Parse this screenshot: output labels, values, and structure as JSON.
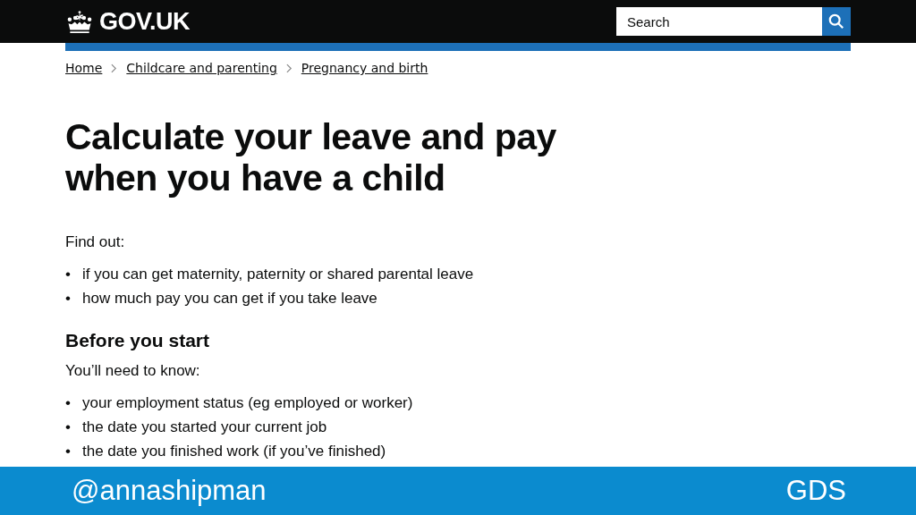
{
  "header": {
    "logo": "GOV.UK",
    "search": {
      "placeholder": "Search"
    }
  },
  "breadcrumbs": [
    "Home",
    "Childcare and parenting",
    "Pregnancy and birth"
  ],
  "title": "Calculate your leave and pay when you have a child",
  "intro": "Find out:",
  "intro_list": [
    {
      "bullet": "•",
      "text": "if you can get maternity, paternity or shared parental leave"
    },
    {
      "bullet": "•",
      "text": "how much pay you can get if you take leave"
    }
  ],
  "section_heading": "Before you start",
  "section_intro": "You’ll need to know:",
  "section_list": [
    {
      "bullet": "•",
      "text": "your employment status (eg employed or worker)"
    },
    {
      "bullet": "•",
      "text": "the date you started your current job"
    },
    {
      "bullet": "•",
      "text": "the date you finished work (if you’ve finished)"
    }
  ],
  "slide_footer": {
    "handle": "@annashipman",
    "org": "GDS"
  }
}
